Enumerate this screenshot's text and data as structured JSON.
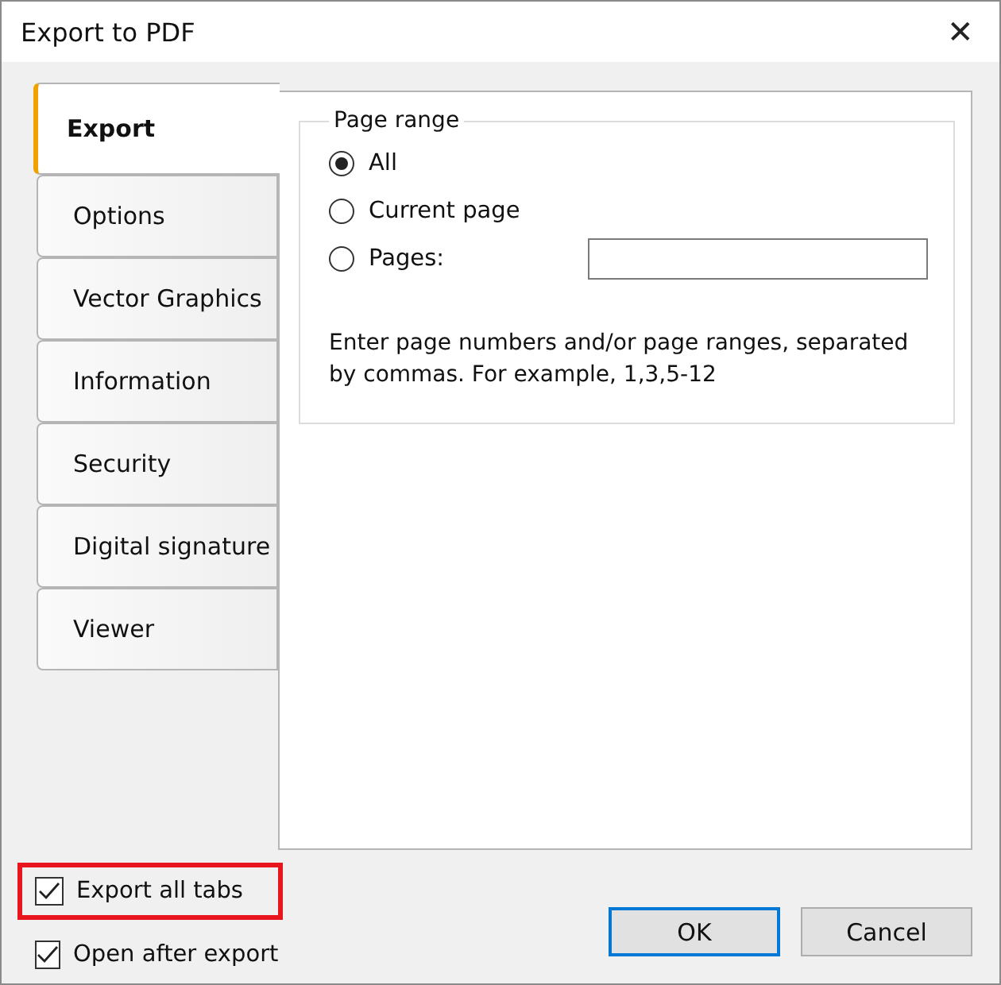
{
  "window": {
    "title": "Export to PDF",
    "close": "✕"
  },
  "tabs": [
    {
      "label": "Export",
      "selected": true
    },
    {
      "label": "Options",
      "selected": false
    },
    {
      "label": "Vector Graphics",
      "selected": false
    },
    {
      "label": "Information",
      "selected": false
    },
    {
      "label": "Security",
      "selected": false
    },
    {
      "label": "Digital signature",
      "selected": false
    },
    {
      "label": "Viewer",
      "selected": false
    }
  ],
  "page_range": {
    "title": "Page range",
    "options": [
      {
        "label": "All",
        "selected": true,
        "kind": "plain"
      },
      {
        "label": "Current page",
        "selected": false,
        "kind": "plain"
      },
      {
        "label": "Pages:",
        "selected": false,
        "kind": "input"
      }
    ],
    "hint": "Enter page numbers and/or page ranges, separated by commas. For example, 1,3,5-12"
  },
  "checkboxes": [
    {
      "label": "Export all tabs",
      "checked": true,
      "highlighted": true
    },
    {
      "label": "Open after export",
      "checked": true,
      "highlighted": false
    }
  ],
  "buttons": [
    {
      "label": "OK",
      "default": true
    },
    {
      "label": "Cancel",
      "default": false
    }
  ]
}
